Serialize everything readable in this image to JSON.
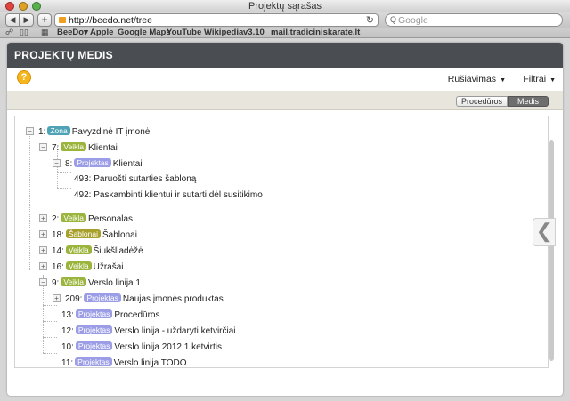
{
  "browser": {
    "window_title": "Projektų sąrašas",
    "url": "http://beedo.net/tree",
    "search_placeholder": "Google",
    "bookmarks": [
      "BeeDo▾",
      "Apple",
      "Google Maps",
      "YouTube",
      "Wikipedia",
      "v3.10",
      "mail.tradiciniskarate.lt"
    ]
  },
  "app": {
    "header_title": "PROJEKTŲ MEDIS",
    "menu": {
      "sort_label": "Rūšiavimas",
      "filter_label": "Filtrai"
    },
    "view_toggle": {
      "procedures_label": "Procedūros",
      "tree_label": "Medis",
      "active": "Medis"
    }
  },
  "tree": [
    {
      "id": "1:",
      "badge": "Zona",
      "badge_type": "zona",
      "label": "Pavyzdinė IT įmonė",
      "toggle": "−"
    },
    {
      "id": "7:",
      "badge": "Veikla",
      "badge_type": "veikla",
      "label": "Klientai",
      "toggle": "−"
    },
    {
      "id": "8:",
      "badge": "Projektas",
      "badge_type": "projektas",
      "label": "Klientai",
      "toggle": "−"
    },
    {
      "id": "493:",
      "badge": "",
      "badge_type": "",
      "label": "Paruošti sutarties šabloną",
      "toggle": ""
    },
    {
      "id": "492:",
      "badge": "",
      "badge_type": "",
      "label": "Paskambinti klientui ir sutarti dėl susitikimo",
      "toggle": ""
    },
    {
      "id": "2:",
      "badge": "Veikla",
      "badge_type": "veikla",
      "label": "Personalas",
      "toggle": "+"
    },
    {
      "id": "18:",
      "badge": "Šablonai",
      "badge_type": "sablonai",
      "label": "Šablonai",
      "toggle": "+"
    },
    {
      "id": "14:",
      "badge": "Veikla",
      "badge_type": "veikla",
      "label": "Šiukšliadėžė",
      "toggle": "+"
    },
    {
      "id": "16:",
      "badge": "Veikla",
      "badge_type": "veikla",
      "label": "Užrašai",
      "toggle": "+"
    },
    {
      "id": "9:",
      "badge": "Veikla",
      "badge_type": "veikla",
      "label": "Verslo linija 1",
      "toggle": "−"
    },
    {
      "id": "209:",
      "badge": "Projektas",
      "badge_type": "projektas",
      "label": "Naujas įmonės produktas",
      "toggle": "+"
    },
    {
      "id": "13:",
      "badge": "Projektas",
      "badge_type": "projektas",
      "label": "Procedūros",
      "toggle": ""
    },
    {
      "id": "12:",
      "badge": "Projektas",
      "badge_type": "projektas",
      "label": "Verslo linija - uždaryti ketvirčiai",
      "toggle": ""
    },
    {
      "id": "10:",
      "badge": "Projektas",
      "badge_type": "projektas",
      "label": "Verslo linija 2012 1 ketvirtis",
      "toggle": ""
    },
    {
      "id": "11:",
      "badge": "Projektas",
      "badge_type": "projektas",
      "label": "Verslo linija TODO",
      "toggle": ""
    }
  ]
}
